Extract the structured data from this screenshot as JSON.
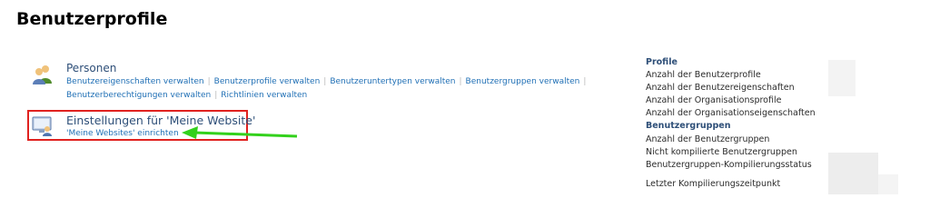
{
  "page": {
    "title": "Benutzerprofile"
  },
  "sections": {
    "personen": {
      "title": "Personen",
      "links": [
        "Benutzereigenschaften verwalten",
        "Benutzerprofile verwalten",
        "Benutzeruntertypen verwalten",
        "Benutzergruppen verwalten",
        "Benutzerberechtigungen verwalten",
        "Richtlinien verwalten"
      ]
    },
    "mysite": {
      "title": "Einstellungen für 'Meine Website'",
      "links": [
        "'Meine Websites' einrichten"
      ]
    }
  },
  "stats": {
    "profile_header": "Profile",
    "profile_items": [
      "Anzahl der Benutzerprofile",
      "Anzahl der Benutzereigenschaften",
      "Anzahl der Organisationsprofile",
      "Anzahl der Organisationseigenschaften"
    ],
    "groups_header": "Benutzergruppen",
    "groups_items": [
      "Anzahl der Benutzergruppen",
      "Nicht kompilierte Benutzergruppen",
      "Benutzergruppen-Kompilierungsstatus"
    ],
    "last_compile": "Letzter Kompilierungszeitpunkt"
  },
  "colors": {
    "highlight_border": "#e0221f",
    "arrow": "#33d11c",
    "link": "#1f6fb5",
    "title": "#2e4f78"
  },
  "icons": {
    "personen": "people-icon",
    "mysite": "monitor-user-icon",
    "arrow": "green-arrow-icon"
  }
}
